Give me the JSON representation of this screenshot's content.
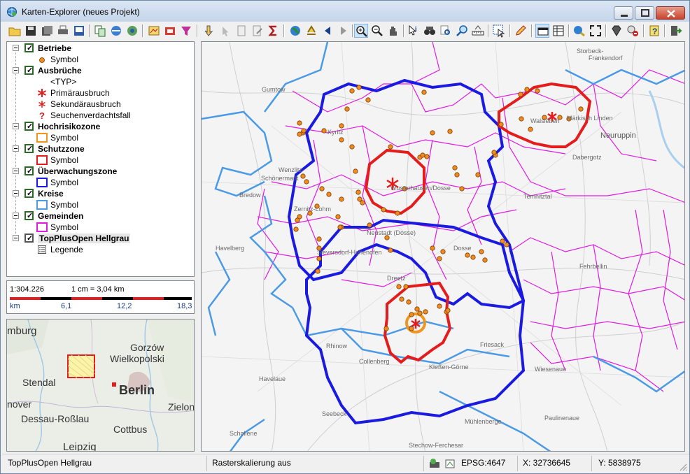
{
  "window": {
    "title": "Karten-Explorer (neues Projekt)"
  },
  "toolbar": {
    "buttons": [
      "open-icon",
      "save-icon",
      "save-as-icon",
      "print-icon",
      "print-preview-icon",
      "copy-icon",
      "layers-icon",
      "globe-sync-icon",
      "map-add-icon",
      "export-icon",
      "filter-icon",
      "select-icon",
      "deselect-icon",
      "document-icon",
      "edit-icon",
      "sum-icon",
      "globe-icon",
      "move-icon",
      "back-icon",
      "forward-icon",
      "zoom-in-icon",
      "zoom-out-icon",
      "pan-icon",
      "info-icon",
      "binoculars-icon",
      "find-icon",
      "measure-icon",
      "cursor-icon",
      "pen-icon",
      "window-icon",
      "table-icon",
      "connect-icon",
      "fullscreen-icon",
      "diamond-icon",
      "delete-icon",
      "help-icon",
      "exit-icon"
    ]
  },
  "legend": {
    "layers": [
      {
        "name": "Betriebe",
        "checked": true,
        "entries": [
          {
            "label": "Symbol",
            "symbol": "orange-dot"
          }
        ]
      },
      {
        "name": "Ausbrüche",
        "checked": true,
        "entries": [
          {
            "label": "<TYP>",
            "symbol": "none"
          },
          {
            "label": "Primärausbruch",
            "symbol": "red-asterisk"
          },
          {
            "label": "Sekundärausbruch",
            "symbol": "red-star-small"
          },
          {
            "label": "Seuchenverdachtsfall",
            "symbol": "red-question"
          }
        ]
      },
      {
        "name": "Hochrisikozone",
        "checked": true,
        "entries": [
          {
            "label": "Symbol",
            "symbol": "orange-box"
          }
        ]
      },
      {
        "name": "Schutzzone",
        "checked": true,
        "entries": [
          {
            "label": "Symbol",
            "symbol": "red-box"
          }
        ]
      },
      {
        "name": "Überwachungszone",
        "checked": true,
        "entries": [
          {
            "label": "Symbol",
            "symbol": "blue-box"
          }
        ]
      },
      {
        "name": "Kreise",
        "checked": true,
        "entries": [
          {
            "label": "Symbol",
            "symbol": "lightblue-box"
          }
        ]
      },
      {
        "name": "Gemeinden",
        "checked": true,
        "entries": [
          {
            "label": "Symbol",
            "symbol": "magenta-box"
          }
        ]
      },
      {
        "name": "TopPlusOpen Hellgrau",
        "checked": true,
        "entries": [
          {
            "label": "Legende",
            "symbol": "legend-icon"
          }
        ]
      }
    ]
  },
  "scale": {
    "ratio": "1:304.226",
    "cm": "1 cm = 3,04 km",
    "ticks": [
      "km",
      "6,1",
      "12,2",
      "18,3"
    ]
  },
  "overview": {
    "labels": [
      "mburg",
      "Gorzów",
      "Wielkopolski",
      "Stendal",
      "Berlin",
      "nover",
      "Zielon",
      "Dessau-Roßlau",
      "Cottbus",
      "Leipzig"
    ]
  },
  "map": {
    "labels": [
      "Storbeck-",
      "Frankendorf",
      "Gumtow",
      "Walsleben",
      "Märkisch Linden",
      "Neuruppin",
      "Kyritz",
      "Dabergotz",
      "Wenzlitz-",
      "Schönermark",
      "Wusterhausen/Dosse",
      "Temnitztal",
      "Bredow",
      "Zernitz-Lohm",
      "Dosse",
      "Neustadt (Dosse)",
      "Havelberg",
      "Sieversdorf-Hohenofen",
      "Dreetz",
      "Fehrbellin",
      "Rhinow",
      "Friesack",
      "Collenberg",
      "Kleßen-Görne",
      "Wiesenaue",
      "Havelaue",
      "Seebeck",
      "Mühlenberge",
      "Paulinenaue",
      "Schollene",
      "Stechow-Ferchesar"
    ]
  },
  "status": {
    "layer": "TopPlusOpen Hellgrau",
    "raster": "Rasterskalierung aus",
    "epsg": "EPSG:4647",
    "x": "X: 32736645",
    "y": "Y: 5838975"
  },
  "colors": {
    "protection_zone": "#e51c1c",
    "surveillance_zone": "#1a1ae0",
    "districts": "#4a9ae6",
    "municipalities": "#e01ce0",
    "farms": "#f08c1e",
    "high_risk": "#f0961e"
  }
}
